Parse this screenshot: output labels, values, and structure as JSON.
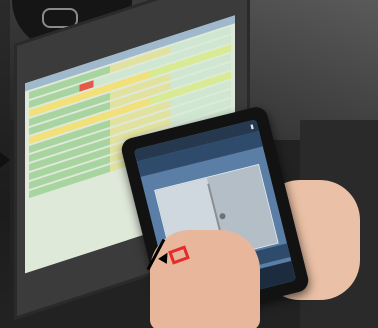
{
  "scene": {
    "subject": "",
    "colors": {
      "annotation_box": "#e52b2b",
      "pointer": "#000000",
      "phone_ui": "#2f4b6b",
      "laptop_ui": "#dfe9da"
    }
  },
  "laptop": {
    "caption": ""
  },
  "phone": {
    "status_time": "",
    "app_title": "",
    "caption": "",
    "nav_left": "",
    "nav_center": "",
    "nav_right": ""
  }
}
